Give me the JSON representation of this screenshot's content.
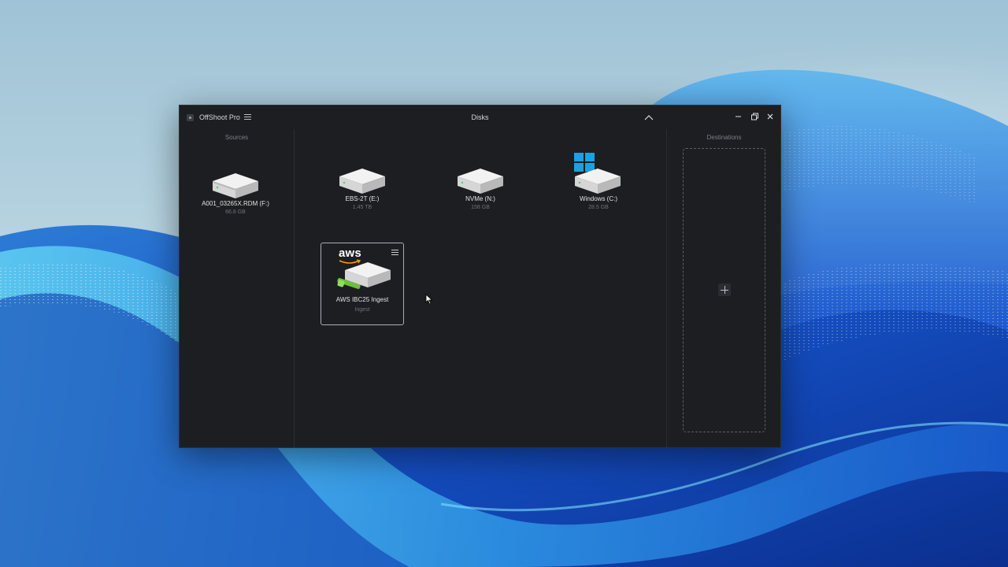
{
  "app": {
    "title": "OffShoot Pro",
    "view_title": "Disks",
    "icons": {
      "menu": "hamburger-icon",
      "collapse": "chevron-up-icon",
      "minimize": "minimize-icon",
      "restore": "restore-icon",
      "close": "close-icon"
    }
  },
  "sources": {
    "label": "Sources",
    "disks": [
      {
        "name": "A001_03265X.RDM  (F:)",
        "size": "66.8 GB"
      }
    ]
  },
  "disks": [
    {
      "name": "EBS-2T  (E:)",
      "size": "1.45 TB"
    },
    {
      "name": "NVMe  (N:)",
      "size": "158 GB"
    },
    {
      "name": "Windows  (C:)",
      "size": "28.5 GB",
      "badge": "windows-logo-icon"
    }
  ],
  "aws_ingest": {
    "logo_text": "aws",
    "name": "AWS IBC25 Ingest",
    "subtitle": "Ingest",
    "icon": "card-menu-icon"
  },
  "destinations": {
    "label": "Destinations",
    "add_icon": "plus-icon"
  },
  "colors": {
    "window_bg": "#1c1e21",
    "text": "#e2e2e2",
    "muted": "#6e7278",
    "windows_blue": "#1ba1e2",
    "aws_green": "#6dbf3a"
  }
}
